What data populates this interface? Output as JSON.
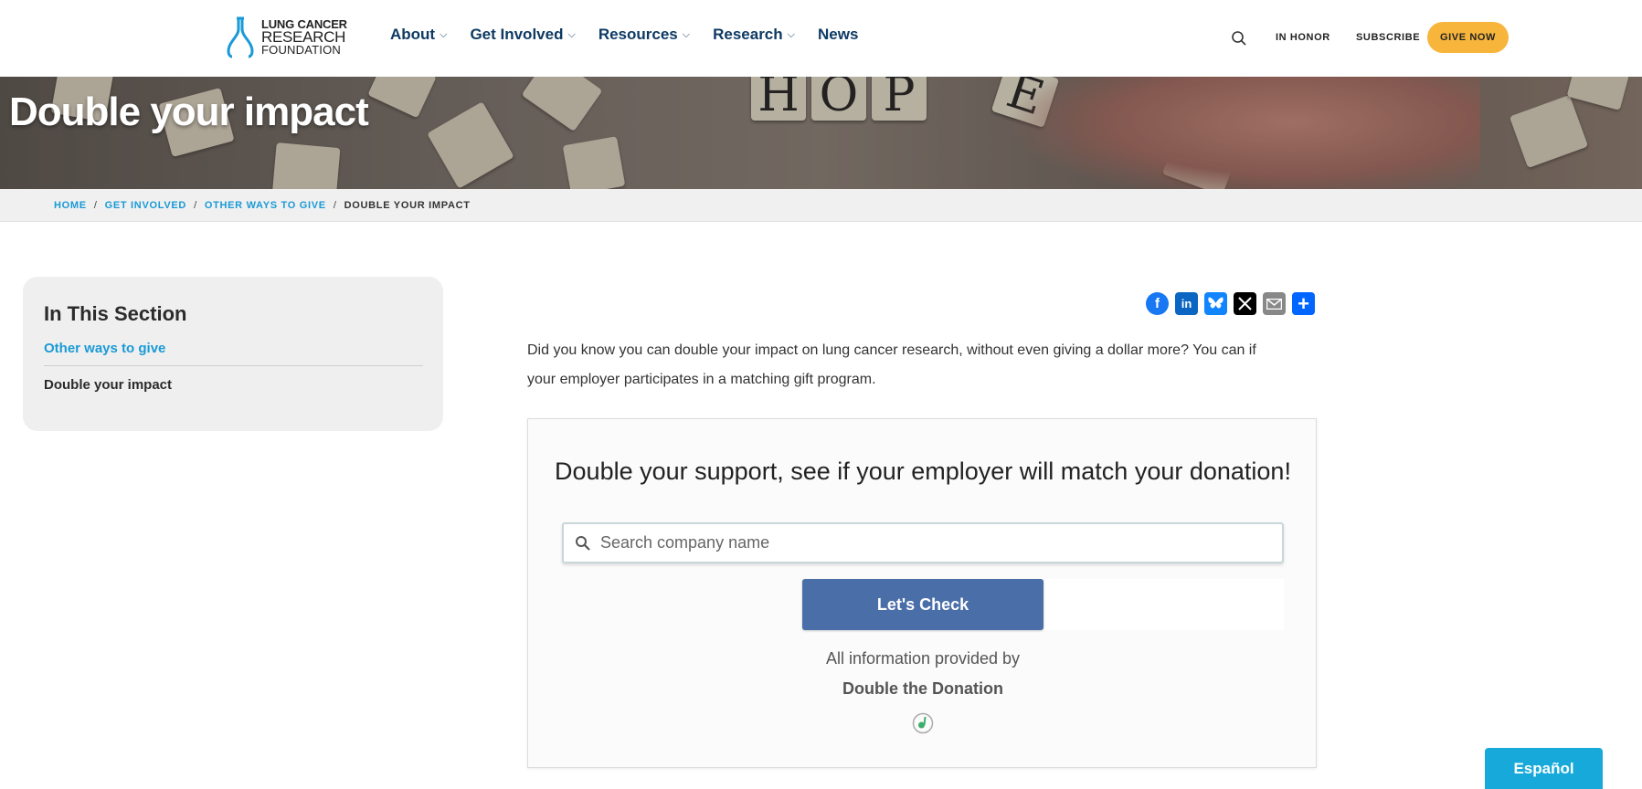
{
  "header": {
    "logo": {
      "line1": "LUNG CANCER",
      "line2": "RESEARCH",
      "line3": "FOUNDATION"
    },
    "nav": [
      {
        "label": "About",
        "has_dropdown": true
      },
      {
        "label": "Get Involved",
        "has_dropdown": true
      },
      {
        "label": "Resources",
        "has_dropdown": true
      },
      {
        "label": "Research",
        "has_dropdown": true
      },
      {
        "label": "News",
        "has_dropdown": false
      }
    ],
    "utility": {
      "search_icon": "search-icon",
      "in_honor": "IN HONOR",
      "subscribe": "SUBSCRIBE",
      "give_now": "GIVE NOW"
    }
  },
  "hero": {
    "title": "Double your impact",
    "image_tiles_text": "HOPE"
  },
  "breadcrumb": {
    "items": [
      "HOME",
      "GET INVOLVED",
      "OTHER WAYS TO GIVE"
    ],
    "current": "DOUBLE YOUR IMPACT",
    "separator": "/"
  },
  "sidebar": {
    "heading": "In This Section",
    "links": [
      {
        "label": "Other ways to give",
        "active": false
      },
      {
        "label": "Double your impact",
        "active": true
      }
    ]
  },
  "share": {
    "icons": [
      "facebook-icon",
      "linkedin-icon",
      "bluesky-icon",
      "x-icon",
      "email-icon",
      "share-icon"
    ],
    "colors": {
      "facebook": "#1877f2",
      "linkedin": "#0a66c2",
      "bluesky": "#1185fe",
      "x": "#000000",
      "email": "#888888",
      "share": "#0166ff"
    }
  },
  "intro": "Did you know you can double your impact on lung cancer research, without even giving a dollar more? You can if your employer participates in a matching gift program.",
  "widget": {
    "heading": "Double your support, see if your employer will match your donation!",
    "search_placeholder": "Search company name",
    "button_label": "Let's Check",
    "info": "All information provided by",
    "brand": "Double the Donation"
  },
  "language_button": "Español",
  "colors": {
    "nav": "#0e3a63",
    "link": "#1a9ad6",
    "give_now": "#f7b53b",
    "widget_button": "#4a6ea8",
    "espanol": "#17a9d9"
  }
}
